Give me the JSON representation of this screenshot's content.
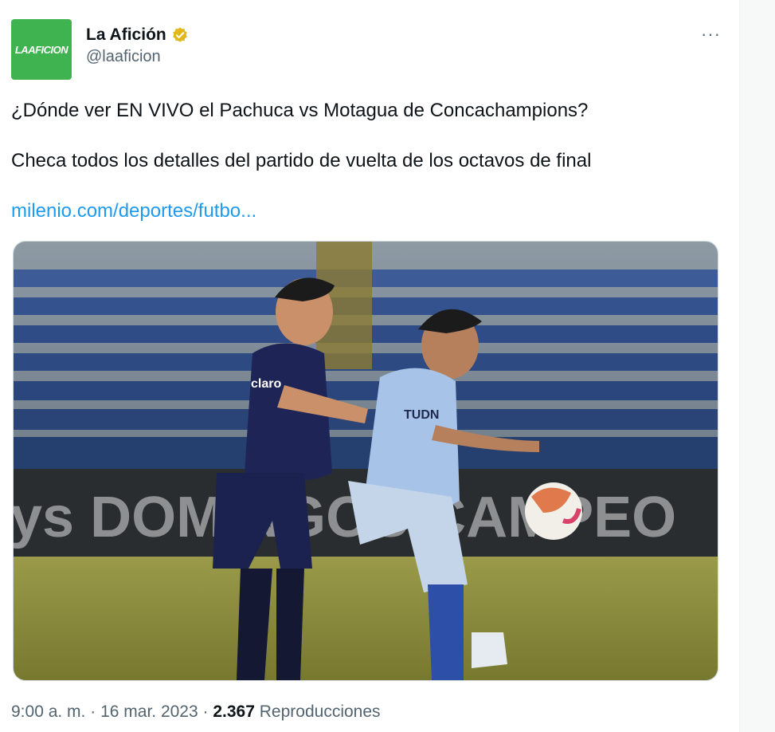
{
  "account": {
    "avatar_text": "LAAFICION",
    "display_name": "La Afición",
    "handle": "@laaficion",
    "verified_badge": "gold-verified-icon",
    "more_label": "···"
  },
  "tweet": {
    "line1": "¿Dónde ver EN VIVO el Pachuca vs Motagua de Concachampions?",
    "line2": "Checa todos los detalles del partido de vuelta de los octavos de final",
    "link": "milenio.com/deportes/futbo...",
    "image": {
      "ad_board_text": "ys DOMINGOS CAMPEO",
      "motagua_shirt_sponsor": "claro",
      "pachuca_shirt_sponsor": "TUDN"
    }
  },
  "meta": {
    "time": "9:00 a. m.",
    "sep1": "·",
    "date": "16 mar. 2023",
    "sep2": "·",
    "views_count": "2.367",
    "views_label": "Reproducciones"
  },
  "colors": {
    "brand_green": "#3fb34f",
    "link_blue": "#1d9bf0",
    "verified_gold": "#e2b719"
  }
}
